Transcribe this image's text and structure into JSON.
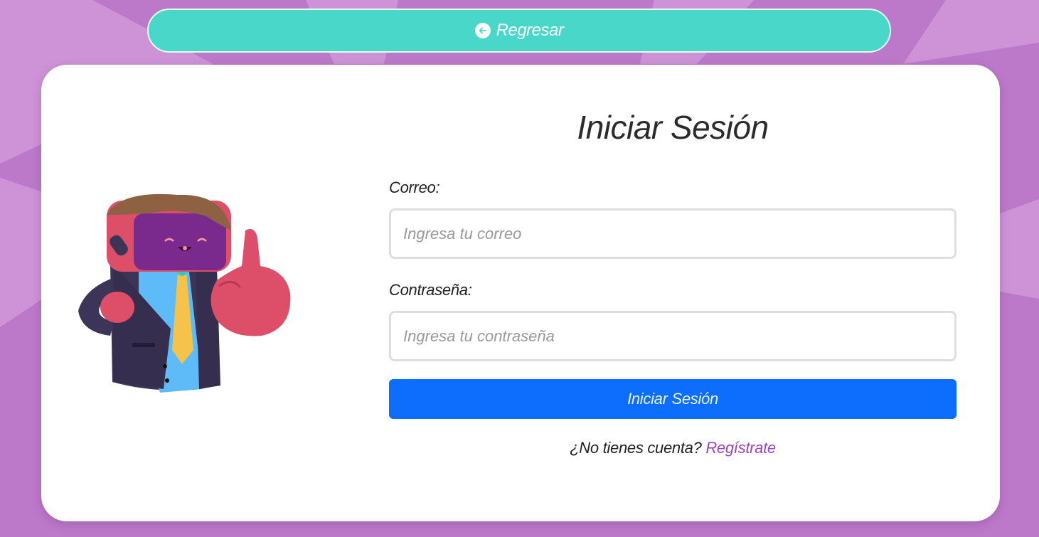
{
  "back_button": {
    "label": "Regresar",
    "icon": "arrow-left-circle-icon"
  },
  "login": {
    "title": "Iniciar Sesión",
    "email": {
      "label": "Correo:",
      "placeholder": "Ingresa tu correo",
      "value": ""
    },
    "password": {
      "label": "Contraseña:",
      "placeholder": "Ingresa tu contraseña",
      "value": ""
    },
    "submit_label": "Iniciar Sesión",
    "register_prompt": "¿No tienes cuenta?",
    "register_link": "Regístrate"
  },
  "colors": {
    "background": "#bd79c9",
    "back_button": "#48d7c8",
    "submit_button": "#0d6efd",
    "link": "#9b45c4"
  }
}
